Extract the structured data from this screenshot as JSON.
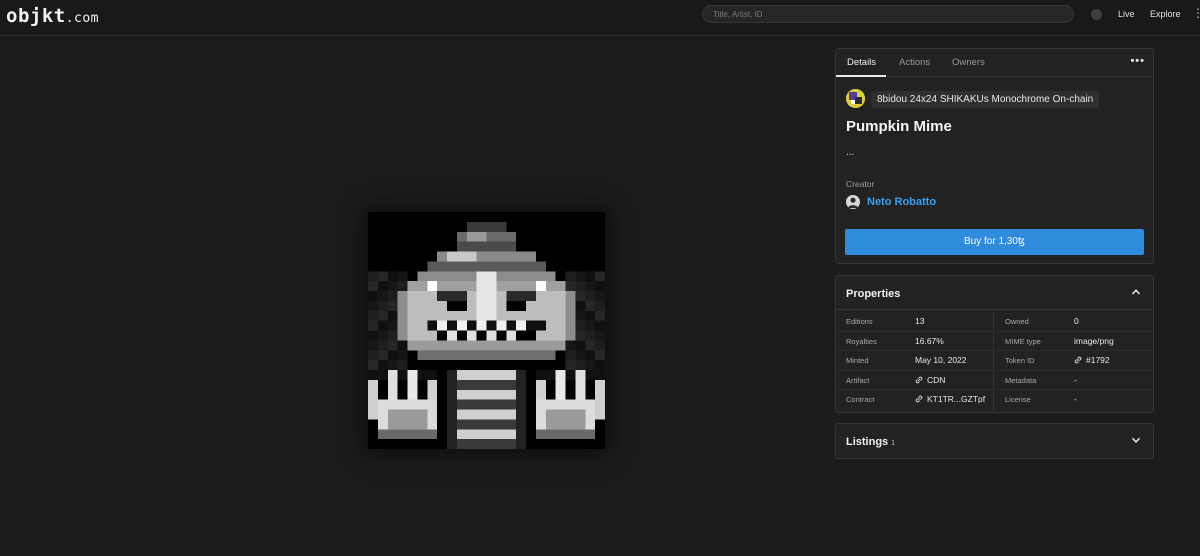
{
  "header": {
    "logo_main": "objkt",
    "logo_suffix": ".com",
    "search_placeholder": "Title, Artist, ID",
    "nav_live": "Live",
    "nav_explore": "Explore"
  },
  "details": {
    "tabs": [
      "Details",
      "Actions",
      "Owners"
    ],
    "active_tab": "Details",
    "more_label": "•••",
    "collection_name": "8bidou 24x24 SHIKAKUs Monochrome On-chain",
    "title": "Pumpkin Mime",
    "description": "...",
    "creator_label": "Creator",
    "creator_name": "Neto Robatto",
    "buy_label": "Buy for 1,30ꜩ"
  },
  "properties": {
    "title": "Properties",
    "rows": [
      {
        "k1": "Editions",
        "v1": "13",
        "k2": "Owned",
        "v2": "0"
      },
      {
        "k1": "Royalties",
        "v1": "16.67%",
        "k2": "MIME type",
        "v2": "image/png"
      },
      {
        "k1": "Minted",
        "v1": "May 10, 2022",
        "k2": "Token ID",
        "v2": "#1792"
      },
      {
        "k1": "Artifact",
        "v1": "CDN",
        "k2": "Metadata",
        "v2": "-"
      },
      {
        "k1": "Contract",
        "v1": "KT1TR...GZTpf",
        "k2": "License",
        "v2": "-"
      }
    ]
  },
  "listings": {
    "title": "Listings",
    "count": "1"
  },
  "colors": {
    "accent": "#3aa0f0",
    "buy_button": "#2f8bdb",
    "background": "#1c1c1c",
    "panel": "#222222"
  },
  "icons": [
    "link-icon",
    "chevron-up-icon",
    "chevron-down-icon",
    "more-icon",
    "user-avatar-icon",
    "collection-icon"
  ]
}
